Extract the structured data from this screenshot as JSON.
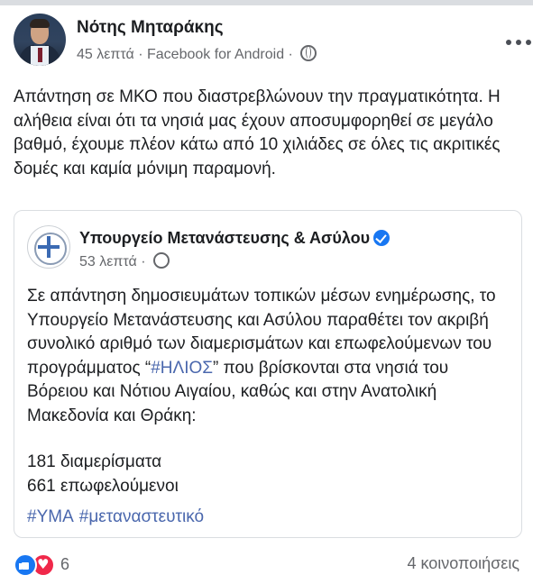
{
  "post": {
    "author": "Νότης Μηταράκης",
    "time": "45 λεπτά",
    "separator": "·",
    "source": "Facebook for Android",
    "text": "Απάντηση σε ΜΚΟ που διαστρεβλώνουν την πραγματικότητα. Η αλήθεια είναι ότι τα νησιά μας έχουν αποσυμφορηθεί σε μεγάλο βαθμό, έχουμε πλέον κάτω από 10 χιλιάδες σε όλες τις ακριτικές δομές και καμία μόνιμη παραμονή."
  },
  "shared": {
    "page_name": "Υπουργείο Μετανάστευσης & Ασύλου",
    "time": "53 λεπτά",
    "separator": "·",
    "text_before": "Σε απάντηση δημοσιευμάτων τοπικών μέσων ενημέρωσης, το Υπουργείο Μετανάστευσης και Ασύλου παραθέτει τον ακριβή συνολικό αριθμό των διαμερισμάτων και επωφελούμενων του προγράμματος “",
    "hashtag_inline": "#ΗΛΙΟΣ",
    "text_after": "” που βρίσκονται στα νησιά του Βόρειου και Νότιου Αιγαίου, καθώς και στην Ανατολική Μακεδονία και Θράκη:",
    "stat_1": "181 διαμερίσματα",
    "stat_2": "661 επωφελούμενοι",
    "tags": [
      "#ΥΜΑ",
      "#μεταναστευτικό"
    ]
  },
  "footer": {
    "reaction_count": "6",
    "shares": "4 κοινοποιήσεις"
  },
  "colors": {
    "link": "#4a67ad",
    "like": "#1877f2",
    "love": "#f0284a",
    "secondary_text": "#65676b"
  },
  "icons": [
    "globe-icon",
    "more-options-icon",
    "verified-badge-icon",
    "like-reaction-icon",
    "love-reaction-icon"
  ]
}
